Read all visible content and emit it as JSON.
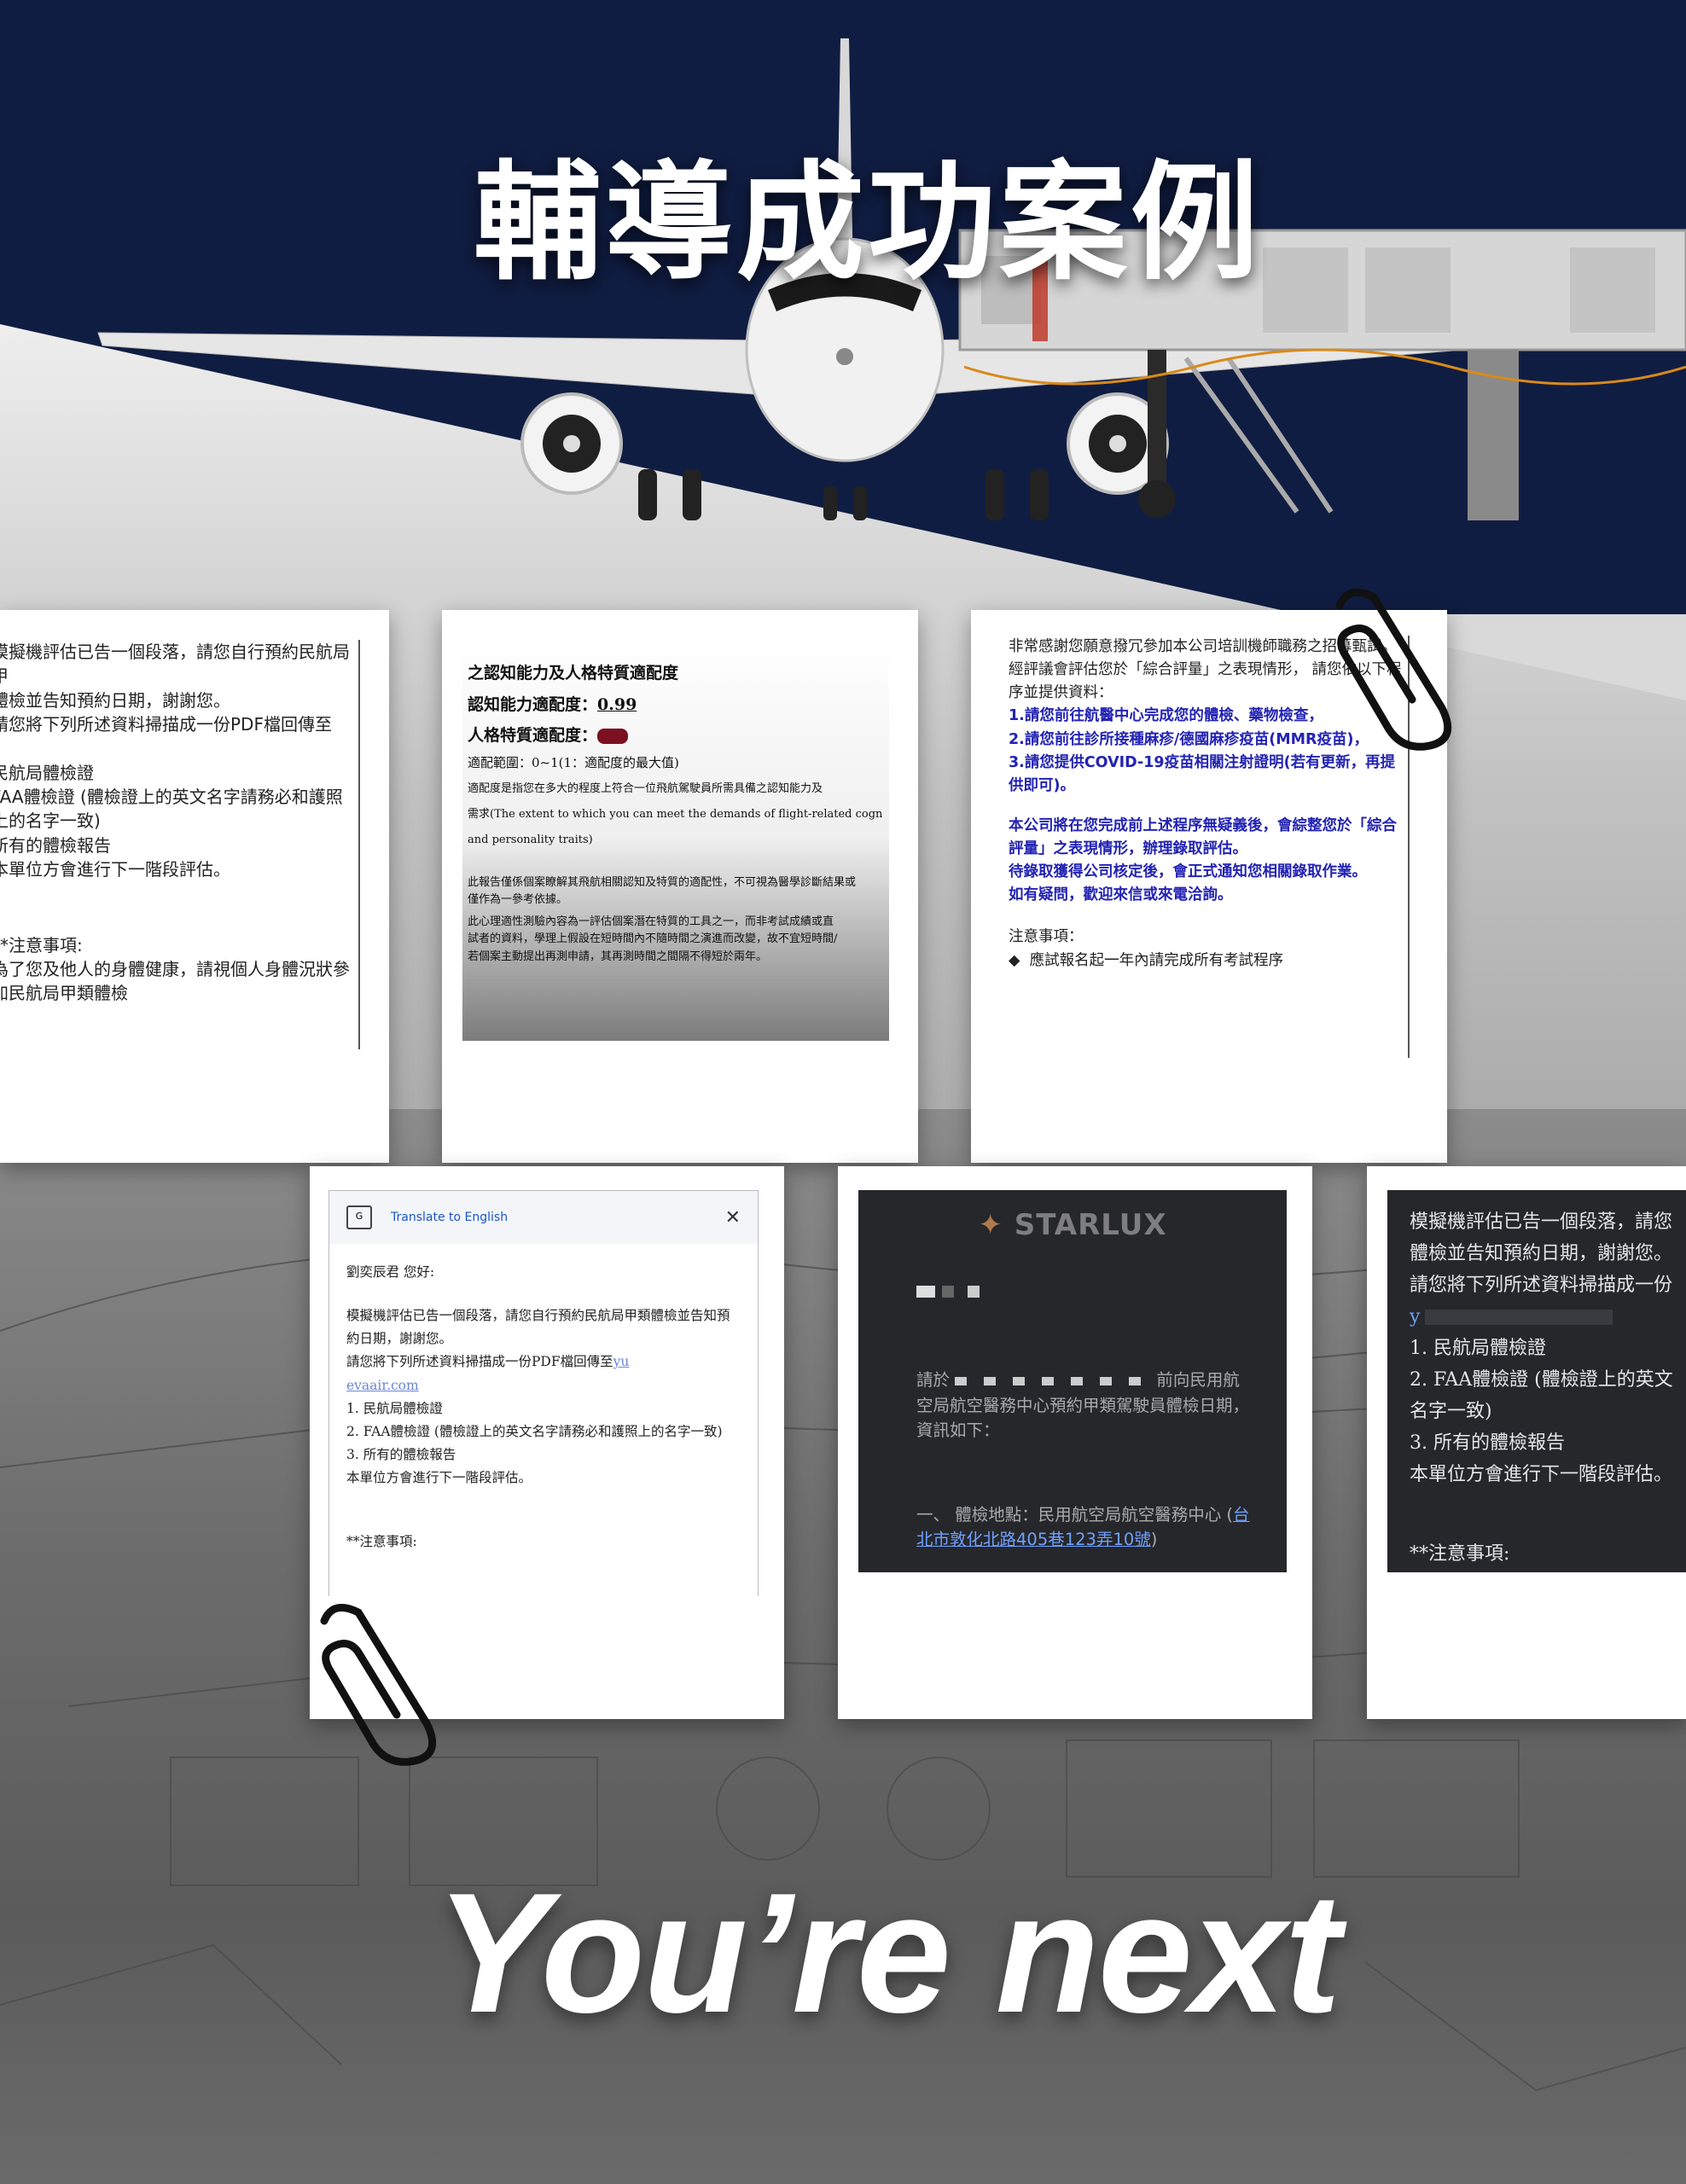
{
  "header": {
    "title": "輔導成功案例"
  },
  "footer": {
    "tagline": "You’re next"
  },
  "cards": {
    "c1": {
      "lines": [
        "模擬機評估已告一個段落，請您自行預約民航局甲",
        "體檢並告知預約日期，謝謝您。",
        "請您將下列所述資料掃描成一份PDF檔回傳至"
      ],
      "items": [
        "民航局體檢證",
        "FAA體檢證 (體檢證上的英文名字請務必和護照上的名字一致)",
        "所有的體檢報告"
      ],
      "after": "本單位方會進行下一階段評估。",
      "note_title": "**注意事項:",
      "note": "為了您及他人的身體健康，請視個人身體況狀參加民航局甲類體檢"
    },
    "c2": {
      "heading": "之認知能力及人格特質適配度",
      "cog_label": "認知能力適配度：",
      "cog_value": "0.99",
      "pers_label": "人格特質適配度：",
      "range": "適配範圍：0~1(1：適配度的最大值)",
      "def": "適配度是指您在多大的程度上符合一位飛航駕駛員所需具備之認知能力及",
      "en1": "需求(The extent to which you can meet the demands of flight-related cogn",
      "en2": "and personality traits)",
      "p1": "此報告僅係個案瞭解其飛航相關認知及特質的適配性，不可視為醫學診斷結果或",
      "p2": "僅作為一參考依據。",
      "p3": "此心理適性測驗內容為一評估個案潛在特質的工具之一，而非考試成績或直",
      "p4": "試者的資料，學理上假設在短時間內不隨時間之演進而改變，故不宜短時間/",
      "p5": "若個案主動提出再測申請，其再測時間之間隔不得短於兩年。"
    },
    "c3": {
      "p1": "非常感謝您願意撥冗參加本公司培訓機師職務之招募甄試。",
      "p2": "經評議會評估您於「綜合評量」之表現情形， 請您依以下程序並提供資料：",
      "b1": "1.請您前往航醫中心完成您的體檢、藥物檢查，",
      "b2": "2.請您前往診所接種麻疹/德國麻疹疫苗(MMR疫苗)，",
      "b3": "3.請您提供COVID-19疫苗相關注射證明(若有更新，再提供即可)。",
      "b4": "本公司將在您完成前上述程序無疑義後，會綜整您於「綜合評量」之表現情形，辦理錄取評估。",
      "b5": "待錄取獲得公司核定後，會正式通知您相關錄取作業。",
      "b6": "如有疑問，歡迎來信或來電洽詢。",
      "note_title": "注意事項：",
      "note": "應試報名起一年內請完成所有考試程序"
    },
    "c4": {
      "translate": "Translate to English",
      "greeting": "劉奕辰君  您好:",
      "p1": "模擬機評估已告一個段落，請您自行預約民航局甲類體檢並告知預約日期，謝謝您。",
      "p2": "請您將下列所述資料掃描成一份PDF檔回傳至",
      "link_a": "yu",
      "link_b": "evaair.com",
      "items": [
        "1. 民航局體檢證",
        "2. FAA體檢證 (體檢證上的英文名字請務必和護照上的名字一致)",
        "3. 所有的體檢報告"
      ],
      "after": "本單位方會進行下一階段評估。",
      "note": "**注意事項:"
    },
    "c5": {
      "brand": "STARLUX",
      "p1a": "請於",
      "p1b": "前向民用航空局航空醫務中心預約甲類駕駛員體檢日期，資訊如下：",
      "p2": "一、 體檢地點：民用航空局航空醫務中心 (",
      "addr": "台北市敦化北路405巷123弄10號",
      "p2end": ")"
    },
    "c6": {
      "lines": [
        "模擬機評估已告一個段落，請您",
        "體檢並告知預約日期，謝謝您。",
        "請您將下列所述資料掃描成一份"
      ],
      "link": "y",
      "items": [
        "1. 民航局體檢證",
        "2. FAA體檢證 (體檢證上的英文",
        "名字一致)",
        "3. 所有的體檢報告",
        "本單位方會進行下一階段評估。"
      ],
      "note": "**注意事項:"
    }
  },
  "colors": {
    "sky": "#101d42",
    "blue_text": "#2323b4",
    "dark_card": "#26272b"
  }
}
